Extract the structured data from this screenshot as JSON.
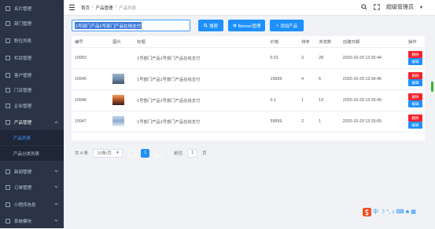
{
  "sidebar": {
    "items": [
      {
        "label": "名片管理",
        "icon": "card-icon"
      },
      {
        "label": "部门管理",
        "icon": "department-icon"
      },
      {
        "label": "职位列表",
        "icon": "position-icon"
      },
      {
        "label": "栏目管理",
        "icon": "column-icon"
      },
      {
        "label": "客户管理",
        "icon": "customer-icon"
      },
      {
        "label": "门店管理",
        "icon": "store-icon"
      },
      {
        "label": "企业管理",
        "icon": "enterprise-icon"
      },
      {
        "label": "产品管理",
        "icon": "product-icon"
      },
      {
        "label": "新闻管理",
        "icon": "news-icon"
      },
      {
        "label": "订单管理",
        "icon": "order-icon"
      },
      {
        "label": "小程序信息",
        "icon": "miniprogram-icon"
      },
      {
        "label": "系统模块",
        "icon": "system-icon"
      }
    ],
    "sub_items": [
      {
        "label": "产品列表",
        "active": true
      },
      {
        "label": "产品分类列表",
        "active": false
      }
    ]
  },
  "topbar": {
    "breadcrumb": [
      "首页",
      "产品管理",
      "产品列表"
    ],
    "admin_label": "超级管理员"
  },
  "toolbar": {
    "search_value": "1号部门产品1号部门产品在线支付",
    "search_label": "搜索",
    "banner_label": "Banner管理",
    "add_label": "添加产品"
  },
  "table": {
    "headers": [
      "编号",
      "图片",
      "标题",
      "价格",
      "排序",
      "浏览数",
      "创建日期",
      "操作"
    ],
    "rows": [
      {
        "id": "10950",
        "image": "none",
        "title": "1号部门产品1号部门产品在线支付",
        "price": "0.01",
        "sort": "3",
        "views": "28",
        "date": "2020-10-29 13:35:44"
      },
      {
        "id": "10949",
        "image": "bird",
        "title": "1号部门产品1号部门产品在线支付",
        "price": "19999",
        "sort": "4",
        "views": "6",
        "date": "2020-10-29 13:34:46"
      },
      {
        "id": "10948",
        "image": "sunset",
        "title": "1号部门产品1号部门产品在线支付",
        "price": "0.1",
        "sort": "1",
        "views": "13",
        "date": "2020-10-29 13:33:49"
      },
      {
        "id": "10947",
        "image": "snow",
        "title": "1号部门产品1号部门产品在线支付",
        "price": "59999",
        "sort": "2",
        "views": "1",
        "date": "2020-10-29 13:33:05"
      }
    ],
    "delete_label": "删除",
    "edit_label": "编辑"
  },
  "pager": {
    "total": "共 4 条",
    "page_size": "10条/页",
    "current": "1",
    "goto_label": "前往",
    "goto_value": "1",
    "page_unit": "页"
  },
  "colors": {
    "sidebar_bg": "#2a3446",
    "accent": "#1e90ff",
    "danger": "#f5222d"
  }
}
